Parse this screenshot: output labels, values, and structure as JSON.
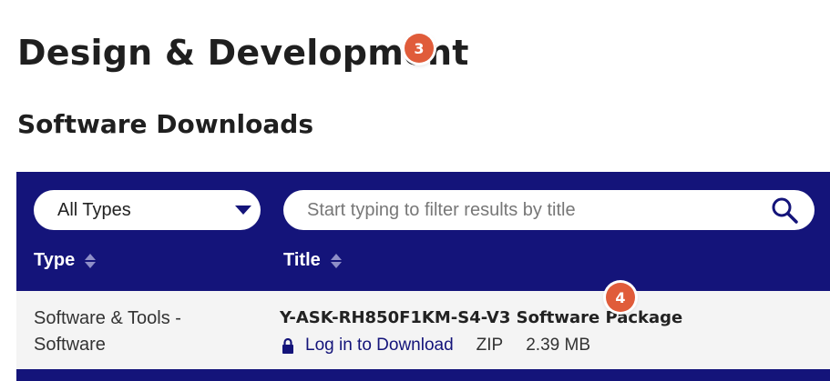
{
  "page": {
    "title": "Design & Development",
    "title_badge": "3",
    "section_title": "Software Downloads"
  },
  "filters": {
    "type_selected": "All Types",
    "search_placeholder": "Start typing to filter results by title"
  },
  "table": {
    "headers": {
      "type": "Type",
      "title": "Title"
    },
    "rows": [
      {
        "type_line1": "Software & Tools -",
        "type_line2": "Software",
        "title": "Y-ASK-RH850F1KM-S4-V3 Software Package",
        "badge": "4",
        "link": "Log in to Download",
        "format": "ZIP",
        "size": "2.39 MB"
      }
    ]
  },
  "colors": {
    "panel": "#14147a",
    "badge": "#e05c3a",
    "row": "#f4f4f4"
  },
  "icons": {
    "select": "caret-down-icon",
    "search": "search-icon",
    "sort": "sort-icon",
    "lock": "lock-icon"
  }
}
